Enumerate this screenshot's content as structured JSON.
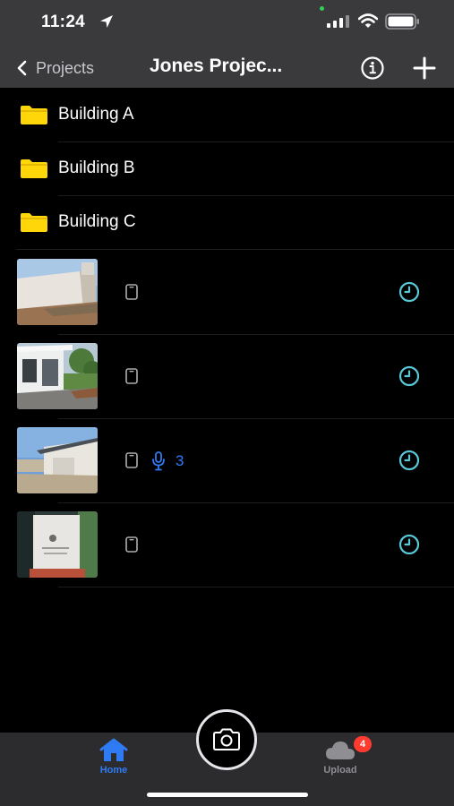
{
  "status": {
    "time": "11:24"
  },
  "nav": {
    "back_label": "Projects",
    "title": "Jones Projec..."
  },
  "folders": [
    {
      "label": "Building A"
    },
    {
      "label": "Building B"
    },
    {
      "label": "Building C"
    }
  ],
  "photos": [
    {
      "scene": "house-wall",
      "source_icon": "phone-icon",
      "status_icon": "clock-icon"
    },
    {
      "scene": "white-house",
      "source_icon": "phone-icon",
      "status_icon": "clock-icon"
    },
    {
      "scene": "garage",
      "source_icon": "phone-icon",
      "voice_notes": "3",
      "status_icon": "clock-icon"
    },
    {
      "scene": "stone-sign",
      "source_icon": "phone-icon",
      "status_icon": "clock-icon"
    }
  ],
  "tabbar": {
    "home_label": "Home",
    "upload_label": "Upload",
    "upload_badge": "4"
  },
  "colors": {
    "folder": "#ffd60a",
    "accent": "#2f7bf5",
    "clock": "#5ac8d8",
    "badge": "#ff3b30",
    "bar": "#3a3a3c"
  }
}
